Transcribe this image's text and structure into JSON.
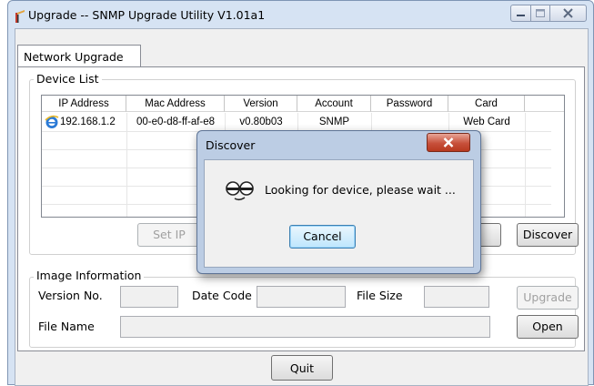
{
  "window": {
    "title": "Upgrade -- SNMP Upgrade Utility V1.01a1",
    "controls": {
      "minimize_icon": "minimize-icon",
      "maximize_icon": "maximize-icon",
      "close_icon": "close-icon"
    }
  },
  "tabs": [
    {
      "label": "Network Upgrade",
      "selected": true
    }
  ],
  "device_list": {
    "label": "Device List",
    "columns": [
      "IP Address",
      "Mac Address",
      "Version",
      "Account",
      "Password",
      "Card"
    ],
    "rows": [
      {
        "icon": "ie-browser-icon",
        "ip": "192.168.1.2",
        "mac": "00-e0-d8-ff-af-e8",
        "version": "v0.80b03",
        "account": "SNMP",
        "password": "",
        "card": "Web Card"
      }
    ],
    "set_ip_label": "Set IP",
    "discover_label": "Discover"
  },
  "image_info": {
    "label": "Image Information",
    "version_no_label": "Version No.",
    "version_no_value": "",
    "date_code_label": "Date Code",
    "date_code_value": "",
    "file_size_label": "File Size",
    "file_size_value": "",
    "file_name_label": "File Name",
    "file_name_value": "",
    "upgrade_label": "Upgrade",
    "open_label": "Open"
  },
  "quit_label": "Quit",
  "dialog": {
    "title": "Discover",
    "message": "Looking for device, please wait ...",
    "icon": "searching-eyes-icon",
    "cancel_label": "Cancel",
    "close_icon": "close-icon"
  }
}
